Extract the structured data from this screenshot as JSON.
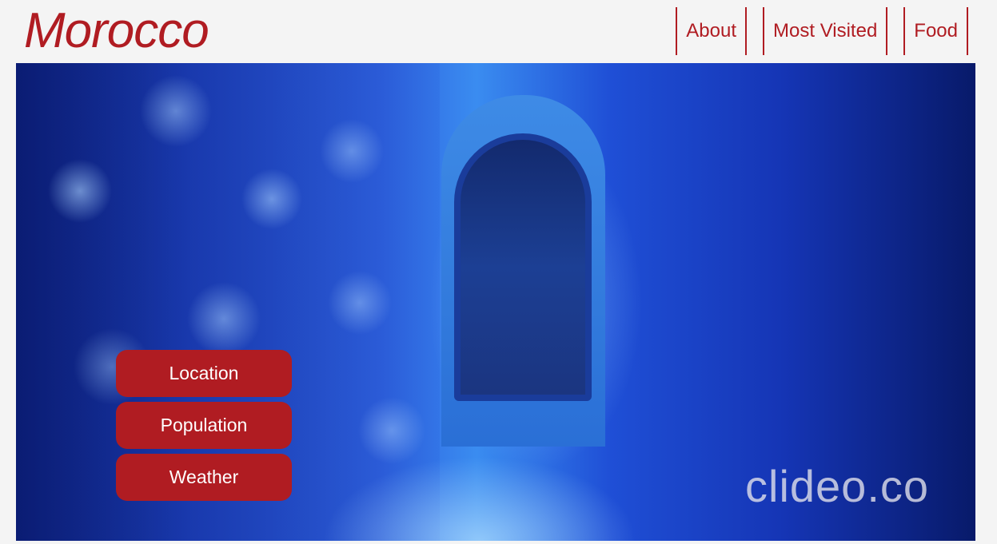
{
  "header": {
    "title": "Morocco",
    "nav": [
      {
        "label": "About"
      },
      {
        "label": "Most Visited"
      },
      {
        "label": "Food"
      }
    ]
  },
  "hero": {
    "watermark": "clideo.co",
    "buttons": [
      {
        "label": "Location"
      },
      {
        "label": "Population"
      },
      {
        "label": "Weather"
      }
    ]
  },
  "colors": {
    "accent": "#b01c22",
    "background": "#f4f4f4",
    "button_text": "#ffffff"
  }
}
